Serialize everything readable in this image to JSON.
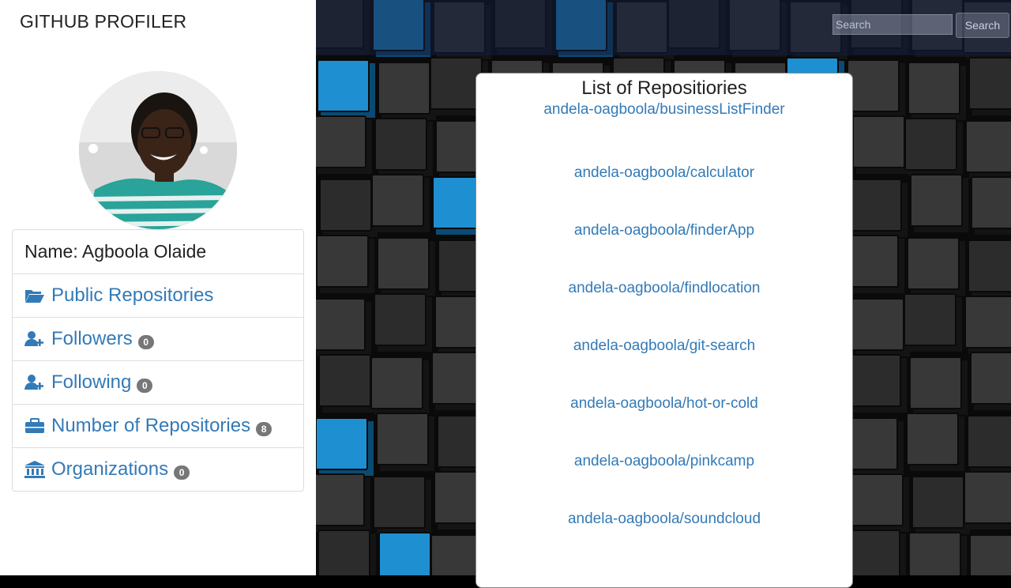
{
  "brand": "GITHUB PROFILER",
  "search": {
    "placeholder": "Search",
    "button_label": "Search"
  },
  "profile": {
    "name_text": "Name: Agboola Olaide",
    "items": [
      {
        "label": "Public Repositories",
        "icon": "folder-open-icon",
        "count": null
      },
      {
        "label": "Followers",
        "icon": "user-plus-icon",
        "count": "0"
      },
      {
        "label": "Following",
        "icon": "user-plus-icon",
        "count": "0"
      },
      {
        "label": "Number of Repositories",
        "icon": "briefcase-icon",
        "count": "8"
      },
      {
        "label": "Organizations",
        "icon": "bank-icon",
        "count": "0"
      }
    ]
  },
  "repos": {
    "title": "List of Repositiories",
    "items": [
      "andela-oagboola/businessListFinder",
      "andela-oagboola/calculator",
      "andela-oagboola/finderApp",
      "andela-oagboola/findlocation",
      "andela-oagboola/git-search",
      "andela-oagboola/hot-or-cold",
      "andela-oagboola/pinkcamp",
      "andela-oagboola/soundcloud"
    ]
  },
  "colors": {
    "link": "#337ab7",
    "badge": "#777777",
    "accent_blue": "#1e8fd0"
  }
}
